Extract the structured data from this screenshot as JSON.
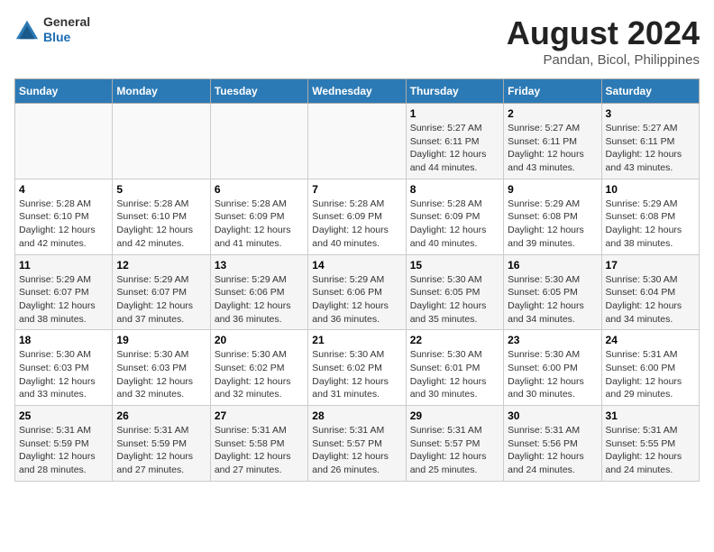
{
  "header": {
    "logo_line1": "General",
    "logo_line2": "Blue",
    "title": "August 2024",
    "subtitle": "Pandan, Bicol, Philippines"
  },
  "weekdays": [
    "Sunday",
    "Monday",
    "Tuesday",
    "Wednesday",
    "Thursday",
    "Friday",
    "Saturday"
  ],
  "weeks": [
    [
      {
        "day": "",
        "info": ""
      },
      {
        "day": "",
        "info": ""
      },
      {
        "day": "",
        "info": ""
      },
      {
        "day": "",
        "info": ""
      },
      {
        "day": "1",
        "info": "Sunrise: 5:27 AM\nSunset: 6:11 PM\nDaylight: 12 hours\nand 44 minutes."
      },
      {
        "day": "2",
        "info": "Sunrise: 5:27 AM\nSunset: 6:11 PM\nDaylight: 12 hours\nand 43 minutes."
      },
      {
        "day": "3",
        "info": "Sunrise: 5:27 AM\nSunset: 6:11 PM\nDaylight: 12 hours\nand 43 minutes."
      }
    ],
    [
      {
        "day": "4",
        "info": "Sunrise: 5:28 AM\nSunset: 6:10 PM\nDaylight: 12 hours\nand 42 minutes."
      },
      {
        "day": "5",
        "info": "Sunrise: 5:28 AM\nSunset: 6:10 PM\nDaylight: 12 hours\nand 42 minutes."
      },
      {
        "day": "6",
        "info": "Sunrise: 5:28 AM\nSunset: 6:09 PM\nDaylight: 12 hours\nand 41 minutes."
      },
      {
        "day": "7",
        "info": "Sunrise: 5:28 AM\nSunset: 6:09 PM\nDaylight: 12 hours\nand 40 minutes."
      },
      {
        "day": "8",
        "info": "Sunrise: 5:28 AM\nSunset: 6:09 PM\nDaylight: 12 hours\nand 40 minutes."
      },
      {
        "day": "9",
        "info": "Sunrise: 5:29 AM\nSunset: 6:08 PM\nDaylight: 12 hours\nand 39 minutes."
      },
      {
        "day": "10",
        "info": "Sunrise: 5:29 AM\nSunset: 6:08 PM\nDaylight: 12 hours\nand 38 minutes."
      }
    ],
    [
      {
        "day": "11",
        "info": "Sunrise: 5:29 AM\nSunset: 6:07 PM\nDaylight: 12 hours\nand 38 minutes."
      },
      {
        "day": "12",
        "info": "Sunrise: 5:29 AM\nSunset: 6:07 PM\nDaylight: 12 hours\nand 37 minutes."
      },
      {
        "day": "13",
        "info": "Sunrise: 5:29 AM\nSunset: 6:06 PM\nDaylight: 12 hours\nand 36 minutes."
      },
      {
        "day": "14",
        "info": "Sunrise: 5:29 AM\nSunset: 6:06 PM\nDaylight: 12 hours\nand 36 minutes."
      },
      {
        "day": "15",
        "info": "Sunrise: 5:30 AM\nSunset: 6:05 PM\nDaylight: 12 hours\nand 35 minutes."
      },
      {
        "day": "16",
        "info": "Sunrise: 5:30 AM\nSunset: 6:05 PM\nDaylight: 12 hours\nand 34 minutes."
      },
      {
        "day": "17",
        "info": "Sunrise: 5:30 AM\nSunset: 6:04 PM\nDaylight: 12 hours\nand 34 minutes."
      }
    ],
    [
      {
        "day": "18",
        "info": "Sunrise: 5:30 AM\nSunset: 6:03 PM\nDaylight: 12 hours\nand 33 minutes."
      },
      {
        "day": "19",
        "info": "Sunrise: 5:30 AM\nSunset: 6:03 PM\nDaylight: 12 hours\nand 32 minutes."
      },
      {
        "day": "20",
        "info": "Sunrise: 5:30 AM\nSunset: 6:02 PM\nDaylight: 12 hours\nand 32 minutes."
      },
      {
        "day": "21",
        "info": "Sunrise: 5:30 AM\nSunset: 6:02 PM\nDaylight: 12 hours\nand 31 minutes."
      },
      {
        "day": "22",
        "info": "Sunrise: 5:30 AM\nSunset: 6:01 PM\nDaylight: 12 hours\nand 30 minutes."
      },
      {
        "day": "23",
        "info": "Sunrise: 5:30 AM\nSunset: 6:00 PM\nDaylight: 12 hours\nand 30 minutes."
      },
      {
        "day": "24",
        "info": "Sunrise: 5:31 AM\nSunset: 6:00 PM\nDaylight: 12 hours\nand 29 minutes."
      }
    ],
    [
      {
        "day": "25",
        "info": "Sunrise: 5:31 AM\nSunset: 5:59 PM\nDaylight: 12 hours\nand 28 minutes."
      },
      {
        "day": "26",
        "info": "Sunrise: 5:31 AM\nSunset: 5:59 PM\nDaylight: 12 hours\nand 27 minutes."
      },
      {
        "day": "27",
        "info": "Sunrise: 5:31 AM\nSunset: 5:58 PM\nDaylight: 12 hours\nand 27 minutes."
      },
      {
        "day": "28",
        "info": "Sunrise: 5:31 AM\nSunset: 5:57 PM\nDaylight: 12 hours\nand 26 minutes."
      },
      {
        "day": "29",
        "info": "Sunrise: 5:31 AM\nSunset: 5:57 PM\nDaylight: 12 hours\nand 25 minutes."
      },
      {
        "day": "30",
        "info": "Sunrise: 5:31 AM\nSunset: 5:56 PM\nDaylight: 12 hours\nand 24 minutes."
      },
      {
        "day": "31",
        "info": "Sunrise: 5:31 AM\nSunset: 5:55 PM\nDaylight: 12 hours\nand 24 minutes."
      }
    ]
  ]
}
